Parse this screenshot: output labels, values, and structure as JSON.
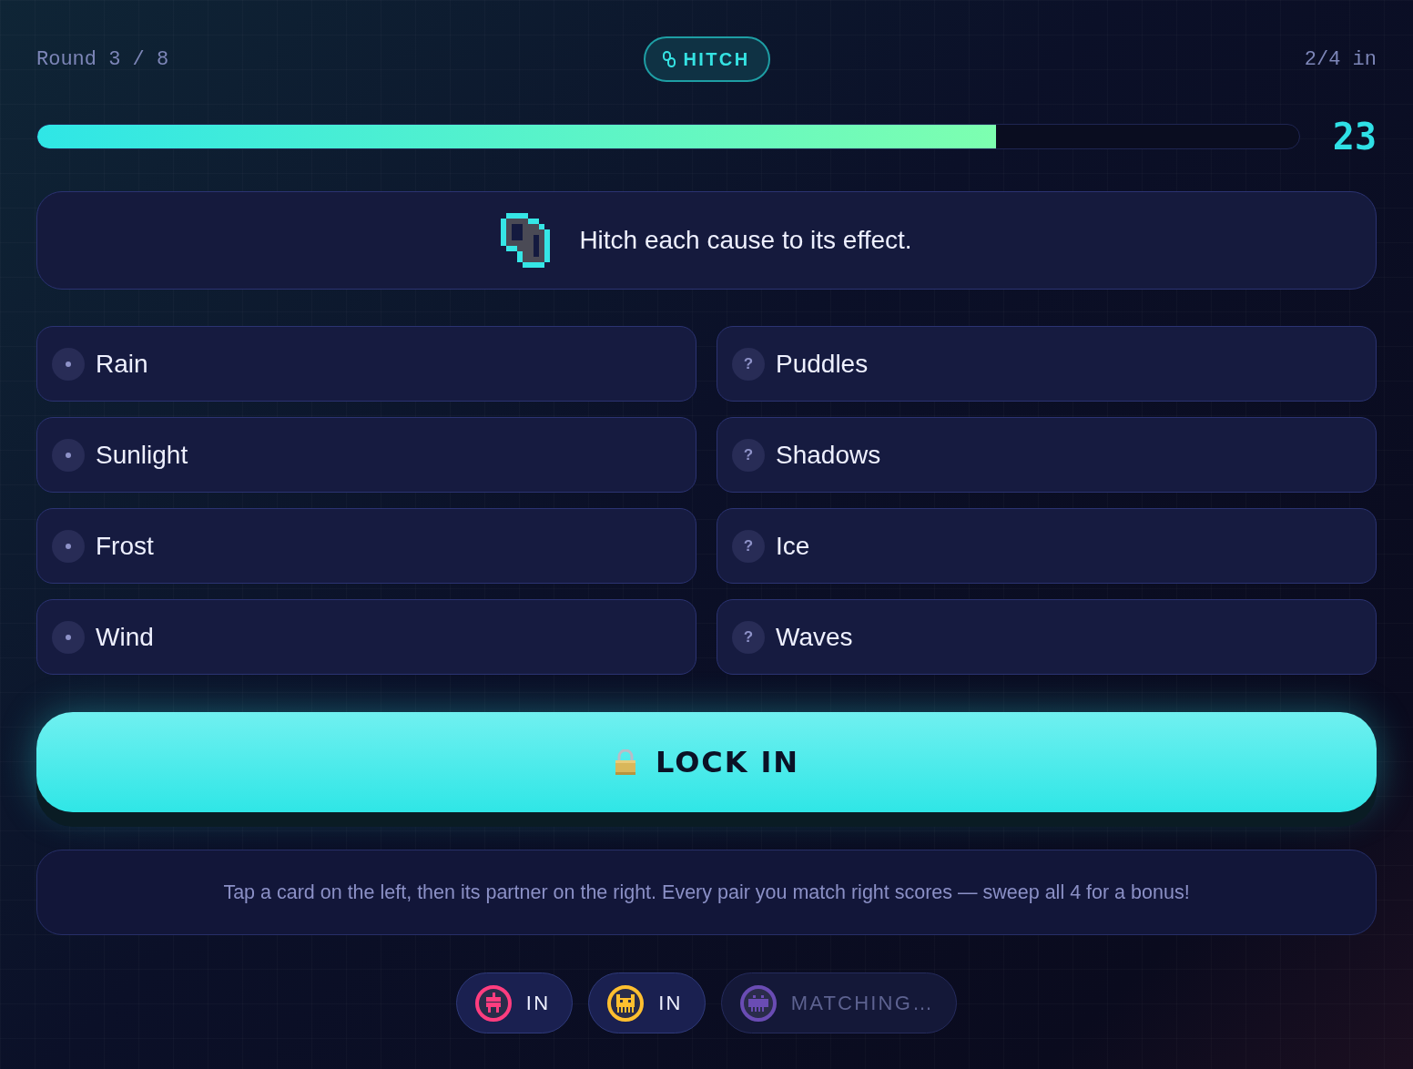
{
  "header": {
    "round": "Round 3 / 8",
    "mode_badge": "HITCH",
    "players_in": "2/4 in"
  },
  "timer": {
    "level": 0.76,
    "seconds": "23"
  },
  "prompt": "Hitch each cause to its effect.",
  "causes": [
    {
      "label": "Rain",
      "selected": false
    },
    {
      "label": "Sunlight",
      "selected": false
    },
    {
      "label": "Frost",
      "selected": false
    },
    {
      "label": "Wind",
      "selected": false
    }
  ],
  "effects": [
    {
      "marker": "?",
      "label": "Puddles",
      "selected": false
    },
    {
      "marker": "?",
      "label": "Shadows",
      "selected": false
    },
    {
      "marker": "?",
      "label": "Ice",
      "selected": false
    },
    {
      "marker": "?",
      "label": "Waves",
      "selected": false
    }
  ],
  "lock_button": "LOCK IN",
  "hint": "Tap a card on the left, then its partner on the right. Every pair you match right scores — sweep all 4 for a bonus!",
  "players": [
    {
      "kind": "robot",
      "color": "#ff3d7f",
      "status": "IN",
      "ready": true
    },
    {
      "kind": "cat",
      "color": "#ffbf2f",
      "status": "IN",
      "ready": true
    },
    {
      "kind": "alien",
      "color": "#6a4cb4",
      "status": "MATCHING…",
      "ready": false
    }
  ]
}
